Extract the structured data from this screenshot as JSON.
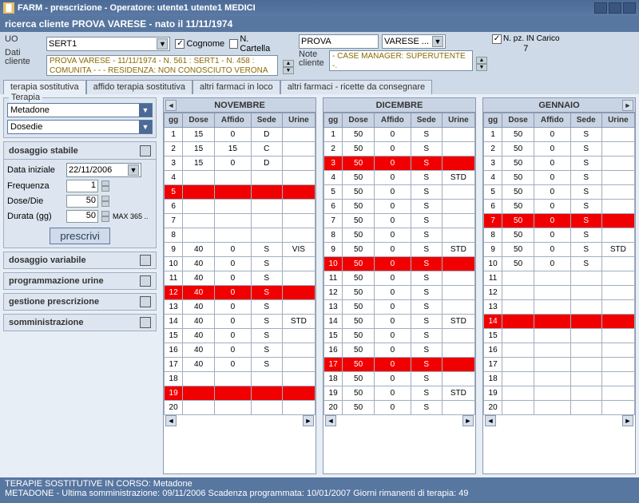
{
  "titlebar": "FARM - prescrizione - Operatore: utente1 utente1  MEDICI",
  "searchbar": "ricerca cliente  PROVA VARESE  - nato il 11/11/1974",
  "client": {
    "uo_label": "UO",
    "uo_value": "SERT1",
    "cognome_label": "Cognome",
    "cartella_label": "N. Cartella",
    "prova_value": "PROVA",
    "varese_value": "VARESE ...",
    "npz_label": "N. pz. IN Carico",
    "npz_value": "7",
    "dati_label": "Dati cliente",
    "dati_text1": "PROVA VARESE - 11/11/1974 - N. 561 : SERT1 - N. 458 :",
    "dati_text2": "COMUNITA -  -  - RESIDENZA: NON CONOSCIUTO VERONA",
    "note_label": "Note cliente",
    "note_text1": "- CASE MANAGER: SUPERUTENTE",
    "note_text2": "-."
  },
  "tabs": [
    "terapia sostitutiva",
    "affido terapia sostitutiva",
    "altri farmaci in loco",
    "altri farmaci - ricette da consegnare"
  ],
  "terapia": {
    "legend": "Terapia",
    "farmaco": "Metadone",
    "dosedie": "Dosedie"
  },
  "dosaggio": {
    "title": "dosaggio stabile",
    "data_iniziale_label": "Data iniziale",
    "data_iniziale_value": "22/11/2006",
    "frequenza_label": "Frequenza",
    "frequenza_value": "1",
    "dosedie_label": "Dose/Die",
    "dosedie_value": "50",
    "durata_label": "Durata (gg)",
    "durata_value": "50",
    "max_label": "MAX 365 ..",
    "prescrivi_btn": "prescrivi"
  },
  "sidebuttons": [
    "dosaggio variabile",
    "programmazione urine",
    "gestione prescrizione",
    "somministrazione"
  ],
  "months": {
    "cols": [
      "gg",
      "Dose",
      "Affido",
      "Sede",
      "Urine"
    ],
    "nov": {
      "title": "NOVEMBRE",
      "rows": [
        {
          "g": "1",
          "d": "15",
          "a": "0",
          "s": "D",
          "u": ""
        },
        {
          "g": "2",
          "d": "15",
          "a": "15",
          "s": "C",
          "u": ""
        },
        {
          "g": "3",
          "d": "15",
          "a": "0",
          "s": "D",
          "u": ""
        },
        {
          "g": "4",
          "d": "",
          "a": "",
          "s": "",
          "u": ""
        },
        {
          "g": "5",
          "d": "",
          "a": "",
          "s": "",
          "u": "",
          "red": true
        },
        {
          "g": "6",
          "d": "",
          "a": "",
          "s": "",
          "u": ""
        },
        {
          "g": "7",
          "d": "",
          "a": "",
          "s": "",
          "u": ""
        },
        {
          "g": "8",
          "d": "",
          "a": "",
          "s": "",
          "u": ""
        },
        {
          "g": "9",
          "d": "40",
          "a": "0",
          "s": "S",
          "u": "VIS"
        },
        {
          "g": "10",
          "d": "40",
          "a": "0",
          "s": "S",
          "u": ""
        },
        {
          "g": "11",
          "d": "40",
          "a": "0",
          "s": "S",
          "u": ""
        },
        {
          "g": "12",
          "d": "40",
          "a": "0",
          "s": "S",
          "u": "",
          "red": true
        },
        {
          "g": "13",
          "d": "40",
          "a": "0",
          "s": "S",
          "u": ""
        },
        {
          "g": "14",
          "d": "40",
          "a": "0",
          "s": "S",
          "u": "STD"
        },
        {
          "g": "15",
          "d": "40",
          "a": "0",
          "s": "S",
          "u": ""
        },
        {
          "g": "16",
          "d": "40",
          "a": "0",
          "s": "S",
          "u": ""
        },
        {
          "g": "17",
          "d": "40",
          "a": "0",
          "s": "S",
          "u": ""
        },
        {
          "g": "18",
          "d": "",
          "a": "",
          "s": "",
          "u": ""
        },
        {
          "g": "19",
          "d": "",
          "a": "",
          "s": "",
          "u": "",
          "red": true
        },
        {
          "g": "20",
          "d": "",
          "a": "",
          "s": "",
          "u": ""
        }
      ]
    },
    "dic": {
      "title": "DICEMBRE",
      "rows": [
        {
          "g": "1",
          "d": "50",
          "a": "0",
          "s": "S",
          "u": ""
        },
        {
          "g": "2",
          "d": "50",
          "a": "0",
          "s": "S",
          "u": ""
        },
        {
          "g": "3",
          "d": "50",
          "a": "0",
          "s": "S",
          "u": "",
          "red": true
        },
        {
          "g": "4",
          "d": "50",
          "a": "0",
          "s": "S",
          "u": "STD"
        },
        {
          "g": "5",
          "d": "50",
          "a": "0",
          "s": "S",
          "u": ""
        },
        {
          "g": "6",
          "d": "50",
          "a": "0",
          "s": "S",
          "u": ""
        },
        {
          "g": "7",
          "d": "50",
          "a": "0",
          "s": "S",
          "u": ""
        },
        {
          "g": "8",
          "d": "50",
          "a": "0",
          "s": "S",
          "u": ""
        },
        {
          "g": "9",
          "d": "50",
          "a": "0",
          "s": "S",
          "u": "STD"
        },
        {
          "g": "10",
          "d": "50",
          "a": "0",
          "s": "S",
          "u": "",
          "red": true
        },
        {
          "g": "11",
          "d": "50",
          "a": "0",
          "s": "S",
          "u": ""
        },
        {
          "g": "12",
          "d": "50",
          "a": "0",
          "s": "S",
          "u": ""
        },
        {
          "g": "13",
          "d": "50",
          "a": "0",
          "s": "S",
          "u": ""
        },
        {
          "g": "14",
          "d": "50",
          "a": "0",
          "s": "S",
          "u": "STD"
        },
        {
          "g": "15",
          "d": "50",
          "a": "0",
          "s": "S",
          "u": ""
        },
        {
          "g": "16",
          "d": "50",
          "a": "0",
          "s": "S",
          "u": ""
        },
        {
          "g": "17",
          "d": "50",
          "a": "0",
          "s": "S",
          "u": "",
          "red": true
        },
        {
          "g": "18",
          "d": "50",
          "a": "0",
          "s": "S",
          "u": ""
        },
        {
          "g": "19",
          "d": "50",
          "a": "0",
          "s": "S",
          "u": "STD"
        },
        {
          "g": "20",
          "d": "50",
          "a": "0",
          "s": "S",
          "u": ""
        }
      ]
    },
    "gen": {
      "title": "GENNAIO",
      "rows": [
        {
          "g": "1",
          "d": "50",
          "a": "0",
          "s": "S",
          "u": ""
        },
        {
          "g": "2",
          "d": "50",
          "a": "0",
          "s": "S",
          "u": ""
        },
        {
          "g": "3",
          "d": "50",
          "a": "0",
          "s": "S",
          "u": ""
        },
        {
          "g": "4",
          "d": "50",
          "a": "0",
          "s": "S",
          "u": ""
        },
        {
          "g": "5",
          "d": "50",
          "a": "0",
          "s": "S",
          "u": ""
        },
        {
          "g": "6",
          "d": "50",
          "a": "0",
          "s": "S",
          "u": ""
        },
        {
          "g": "7",
          "d": "50",
          "a": "0",
          "s": "S",
          "u": "",
          "red": true
        },
        {
          "g": "8",
          "d": "50",
          "a": "0",
          "s": "S",
          "u": ""
        },
        {
          "g": "9",
          "d": "50",
          "a": "0",
          "s": "S",
          "u": "STD"
        },
        {
          "g": "10",
          "d": "50",
          "a": "0",
          "s": "S",
          "u": ""
        },
        {
          "g": "11",
          "d": "",
          "a": "",
          "s": "",
          "u": ""
        },
        {
          "g": "12",
          "d": "",
          "a": "",
          "s": "",
          "u": ""
        },
        {
          "g": "13",
          "d": "",
          "a": "",
          "s": "",
          "u": ""
        },
        {
          "g": "14",
          "d": "",
          "a": "",
          "s": "",
          "u": "",
          "red": true
        },
        {
          "g": "15",
          "d": "",
          "a": "",
          "s": "",
          "u": ""
        },
        {
          "g": "16",
          "d": "",
          "a": "",
          "s": "",
          "u": ""
        },
        {
          "g": "17",
          "d": "",
          "a": "",
          "s": "",
          "u": ""
        },
        {
          "g": "18",
          "d": "",
          "a": "",
          "s": "",
          "u": ""
        },
        {
          "g": "19",
          "d": "",
          "a": "",
          "s": "",
          "u": ""
        },
        {
          "g": "20",
          "d": "",
          "a": "",
          "s": "",
          "u": ""
        }
      ]
    }
  },
  "status": {
    "line1": "TERAPIE SOSTITUTIVE IN CORSO:  Metadone",
    "line2": "METADONE -  Ultima somministrazione: 09/11/2006  Scadenza programmata: 10/01/2007 Giorni rimanenti di terapia: 49"
  }
}
